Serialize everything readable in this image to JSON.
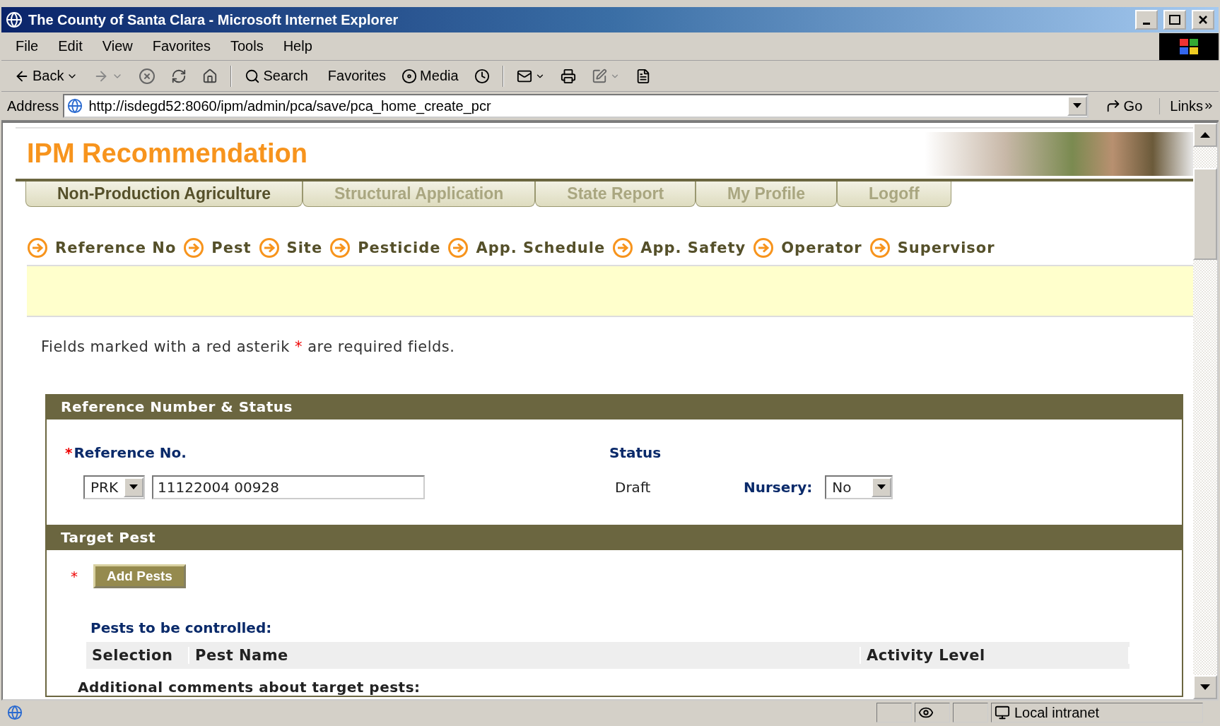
{
  "window": {
    "title": "The County of Santa Clara - Microsoft Internet Explorer"
  },
  "menu": [
    "File",
    "Edit",
    "View",
    "Favorites",
    "Tools",
    "Help"
  ],
  "toolbar": {
    "back": "Back",
    "search": "Search",
    "favorites": "Favorites",
    "media": "Media"
  },
  "address": {
    "label": "Address",
    "value": "http://isdegd52:8060/ipm/admin/pca/save/pca_home_create_pcr",
    "go": "Go",
    "links": "Links"
  },
  "page": {
    "heading": "IPM Recommendation",
    "tabs": [
      {
        "label": "Non-Production Agriculture",
        "selected": true
      },
      {
        "label": "Structural Application",
        "selected": false
      },
      {
        "label": "State Report",
        "selected": false
      },
      {
        "label": "My Profile",
        "selected": false
      },
      {
        "label": "Logoff",
        "selected": false
      }
    ],
    "steps": [
      "Reference No",
      "Pest",
      "Site",
      "Pesticide",
      "App. Schedule",
      "App. Safety",
      "Operator",
      "Supervisor"
    ],
    "note": {
      "before": "Fields marked with a red asterik",
      "marker": "*",
      "after": "are required fields."
    },
    "reference_section": {
      "title": "Reference Number & Status",
      "reference_label": "Reference No.",
      "required_marker": "*",
      "prefix": "PRK",
      "number": "11122004 00928",
      "status_label": "Status",
      "status": "Draft",
      "nursery_label": "Nursery:",
      "nursery": "No"
    },
    "target_pest_section": {
      "title": "Target Pest",
      "required_marker": "*",
      "add_button": "Add Pests",
      "pests_label": "Pests to be controlled:",
      "columns": [
        "Selection",
        "Pest Name",
        "Activity Level"
      ],
      "comments_label": "Additional comments about target pests:"
    }
  },
  "status_bar": {
    "zone": "Local intranet"
  }
}
